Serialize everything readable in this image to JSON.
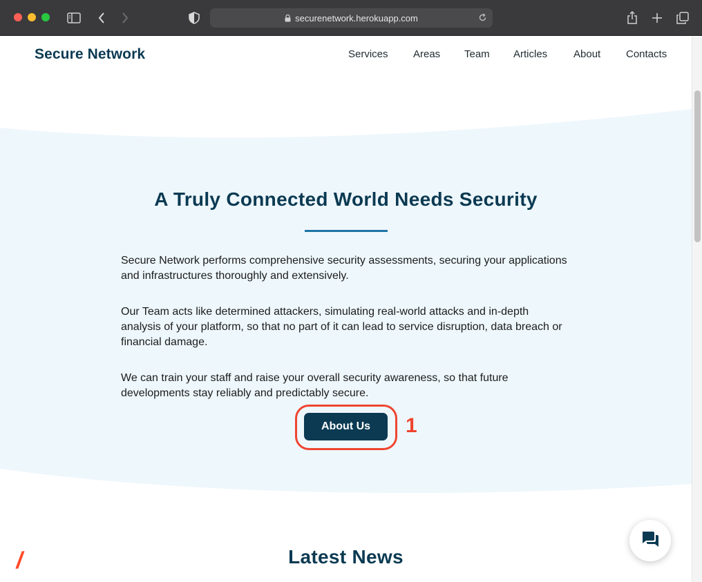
{
  "browser": {
    "url": "securenetwork.herokuapp.com"
  },
  "site": {
    "brand": "Secure Network",
    "nav": [
      "Services",
      "Areas",
      "Team",
      "Articles",
      "About",
      "Contacts"
    ]
  },
  "hero": {
    "title": "A Truly Connected World Needs Security",
    "paragraphs": [
      "Secure Network performs comprehensive security assessments, securing your applications and infrastructures thoroughly and extensively.",
      "Our Team acts like determined attackers, simulating real-world attacks and in-depth analysis of your platform, so that no part of it can lead to service disruption, data breach or financial damage.",
      "We can train your staff and raise your overall security awareness, so that future developments stay reliably and predictably secure."
    ],
    "button_label": "About Us"
  },
  "annotation": {
    "label": "1",
    "color": "#ef4530"
  },
  "news": {
    "title": "Latest News",
    "decor": "/"
  },
  "colors": {
    "brand_navy": "#0b3a52",
    "hero_background": "#eef7fc",
    "accent_blue": "#1d74a6",
    "accent_orange": "#ff4a2a"
  },
  "icons": {
    "chat": "chat-bubbles-icon"
  }
}
